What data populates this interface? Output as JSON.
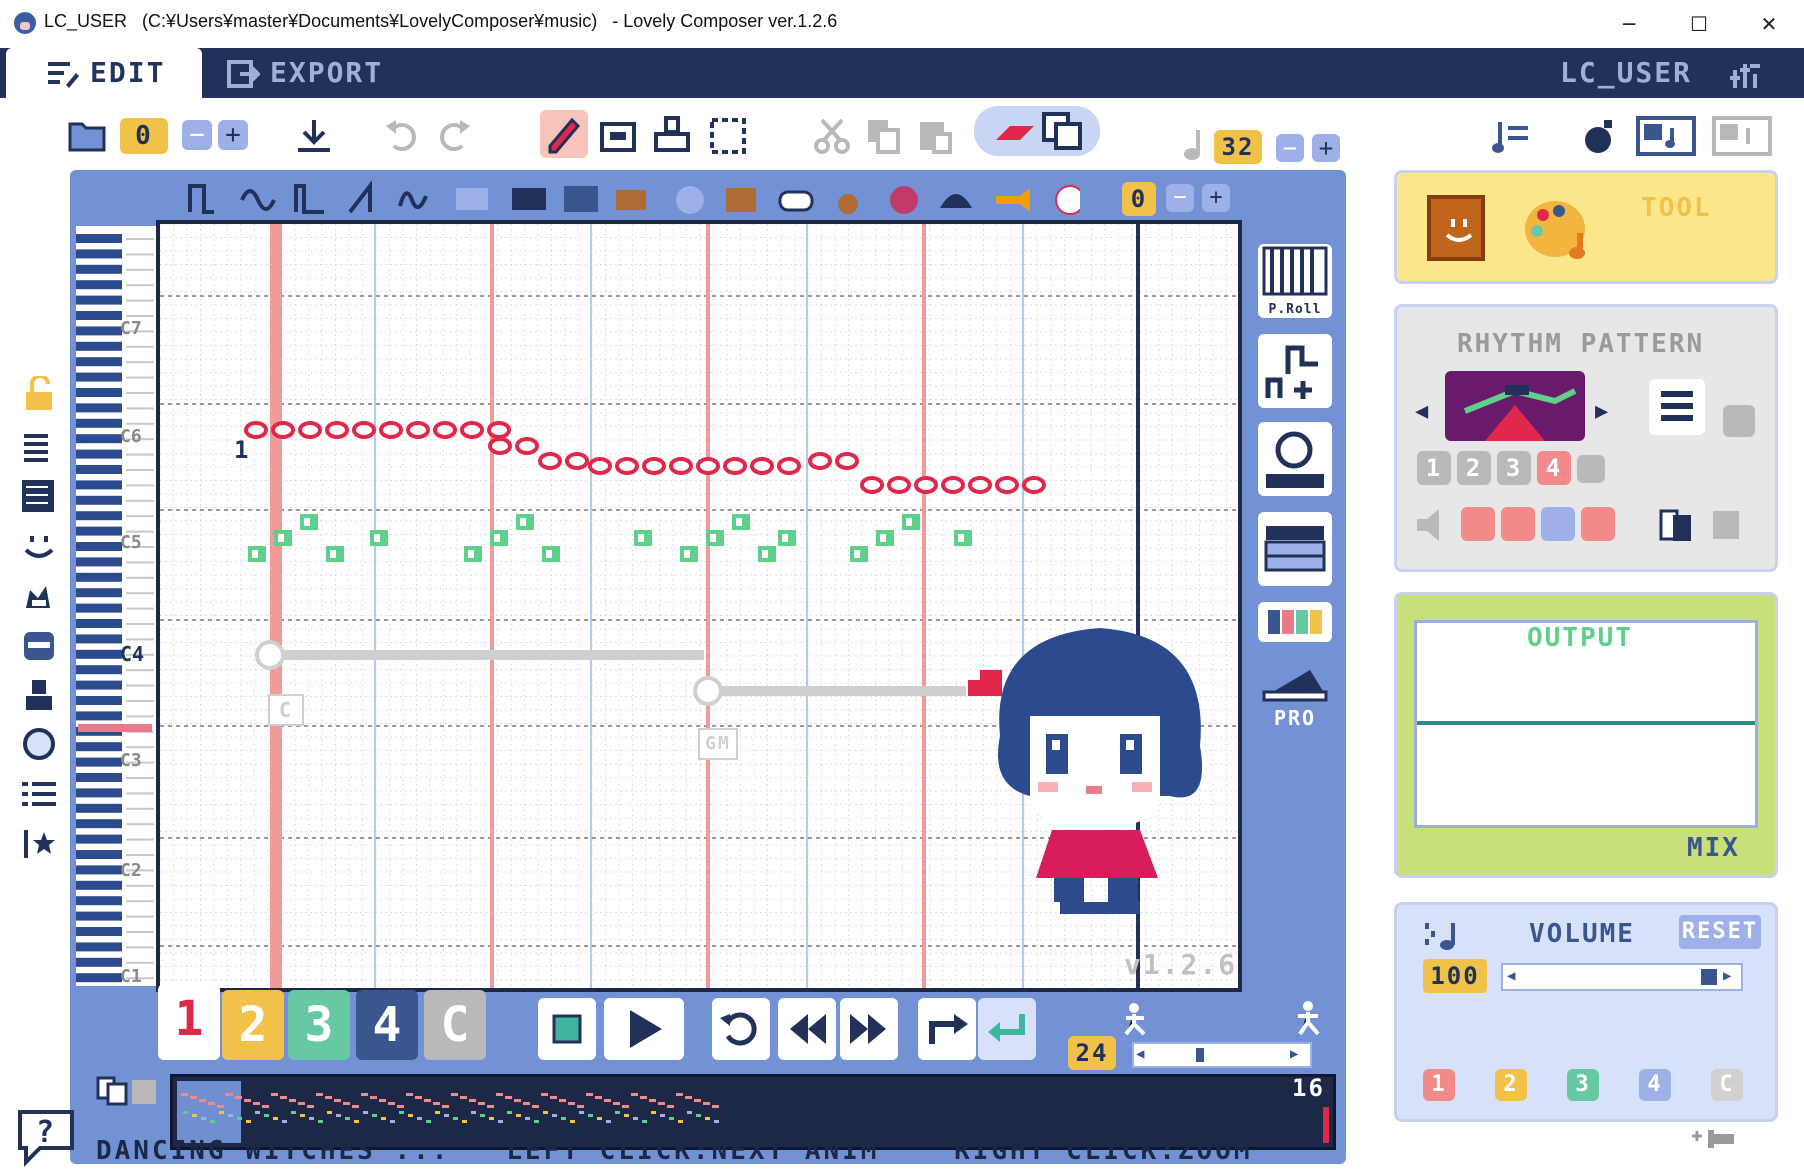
{
  "window": {
    "title": "LC_USER   (C:¥Users¥master¥Documents¥LovelyComposer¥music)   - Lovely Composer ver.1.2.6",
    "minimize": "─",
    "maximize": "☐",
    "close": "✕"
  },
  "tabs": {
    "edit": "EDIT",
    "export": "EXPORT"
  },
  "user": "LC_USER",
  "toolbar": {
    "page_number": "0",
    "note_length": "32",
    "instrument_number": "0"
  },
  "piano_roll": {
    "marker": "1",
    "octave_labels": [
      "C7",
      "C6",
      "C5",
      "C4",
      "C3",
      "C2",
      "C1"
    ],
    "chord_labels": [
      "C",
      "GM"
    ],
    "version_watermark": "v1.2.6"
  },
  "side_tools": {
    "proll": "P.Roll",
    "pro": "PRO"
  },
  "track_tabs": [
    "1",
    "2",
    "3",
    "4",
    "C"
  ],
  "transport": {
    "tempo_value": "24"
  },
  "timeline": {
    "end_page": "16"
  },
  "status": "DANCING WITCHES ...   LEFT CLICK:NEXT ANIM    RIGHT CLICK:ZOOM",
  "panels": {
    "tool_title": "TOOL",
    "rhythm_title": "RHYTHM PATTERN",
    "rhythm_slots": [
      "1",
      "2",
      "3",
      "4"
    ],
    "output_title": "OUTPUT",
    "mix_label": "MIX",
    "volume_title": "VOLUME",
    "reset_label": "RESET",
    "volume_value": "100",
    "volume_tracks": [
      "1",
      "2",
      "3",
      "4",
      "C"
    ]
  },
  "colors": {
    "header": "#22315a",
    "panel_blue": "#7392d6",
    "note_red": "#e0284a",
    "note_green": "#5ed08a",
    "track1": "#ffffff",
    "track2": "#f0c24a",
    "track3": "#67c9a4",
    "track4": "#3a568e",
    "trackC": "#b9b9b9"
  }
}
